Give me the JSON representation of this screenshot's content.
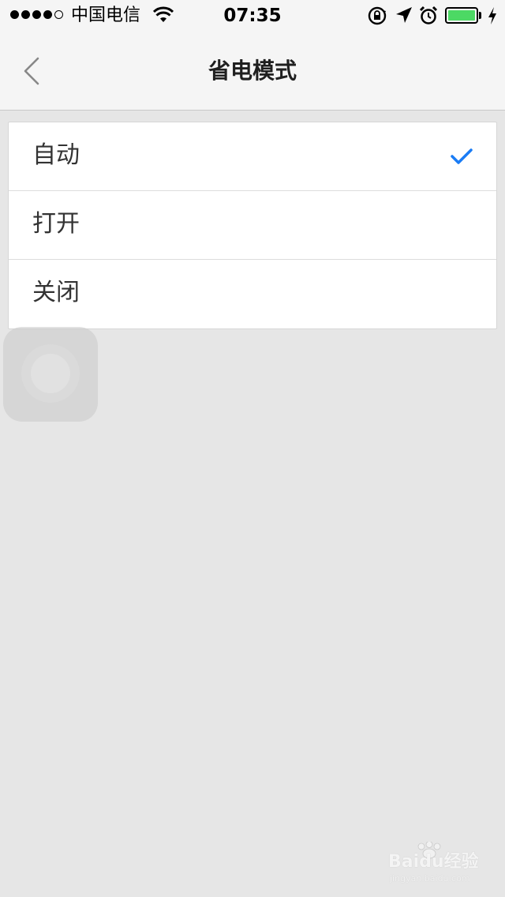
{
  "status_bar": {
    "carrier": "中国电信",
    "time": "07:35",
    "signal_bars_filled": 4,
    "signal_bars_total": 5,
    "battery_level": 1.0,
    "battery_color": "#4cd964"
  },
  "nav": {
    "title": "省电模式",
    "back_icon": "chevron-left-icon"
  },
  "options": [
    {
      "label": "自动",
      "selected": true
    },
    {
      "label": "打开",
      "selected": false
    },
    {
      "label": "关闭",
      "selected": false
    }
  ],
  "accent_color": "#1a7cf5",
  "watermark": {
    "main": "Baidu经验",
    "sub": "jingyan.baidu.com"
  }
}
